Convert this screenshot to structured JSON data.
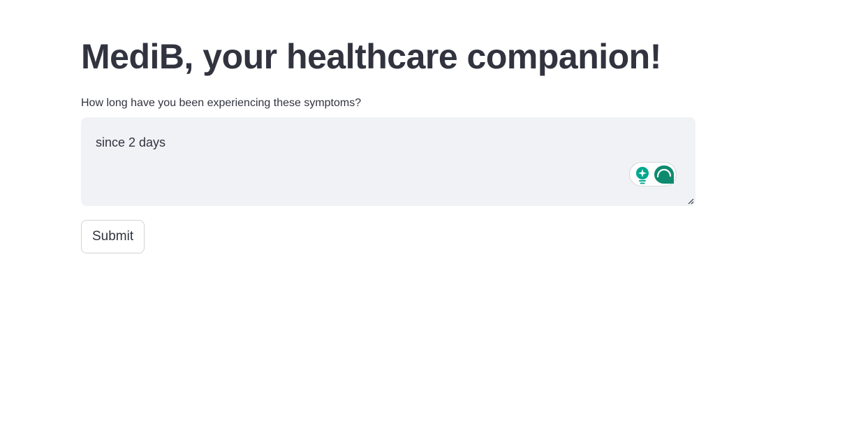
{
  "header": {
    "title": "MediB, your healthcare companion!"
  },
  "form": {
    "question_label": "How long have you been experiencing these symptoms?",
    "answer_value": "since 2 days",
    "submit_label": "Submit"
  },
  "widget": {
    "icons": [
      "lightbulb-sparkle-icon",
      "assistant-logo-icon"
    ],
    "accent_color": "#00a88f",
    "logo_color": "#0e8a6f"
  },
  "colors": {
    "text": "#31333f",
    "input_background": "#f0f2f6"
  }
}
